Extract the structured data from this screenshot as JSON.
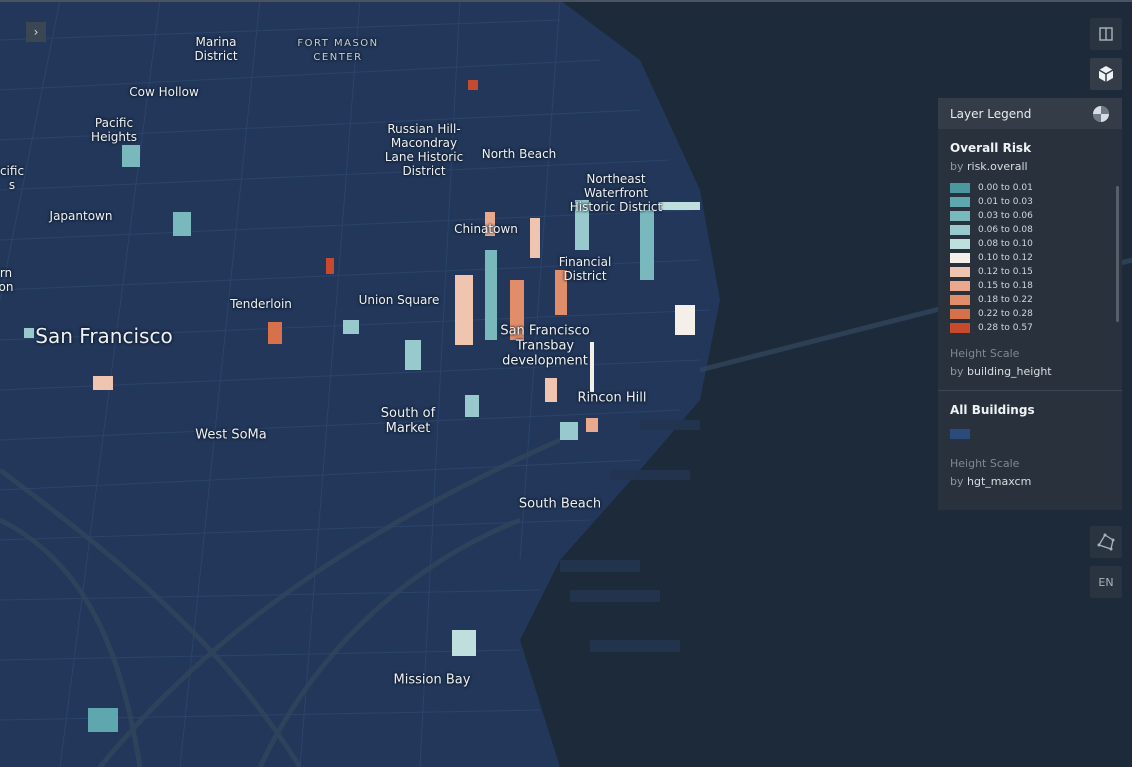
{
  "places": [
    {
      "id": "marina-district",
      "text": "Marina\nDistrict",
      "size": "small"
    },
    {
      "id": "fort-mason-center",
      "text": "FORT MASON\nCENTER",
      "size": "fm"
    },
    {
      "id": "cow-hollow",
      "text": "Cow Hollow",
      "size": "small"
    },
    {
      "id": "pacific-heights",
      "text": "Pacific\nHeights",
      "size": "small"
    },
    {
      "id": "pacific-cut",
      "text": "cific\ns",
      "size": "small"
    },
    {
      "id": "russian-hill",
      "text": "Russian Hill-\nMacondray\nLane Historic\nDistrict",
      "size": "small"
    },
    {
      "id": "north-beach",
      "text": "North Beach",
      "size": "small"
    },
    {
      "id": "northeast-waterfront",
      "text": "Northeast\nWaterfront\nHistoric District",
      "size": "small"
    },
    {
      "id": "japantown",
      "text": "Japantown",
      "size": "small"
    },
    {
      "id": "chinatown",
      "text": "Chinatown",
      "size": "small"
    },
    {
      "id": "financial-district",
      "text": "Financial\nDistrict",
      "size": "small"
    },
    {
      "id": "western-addition-cut",
      "text": "rn\non",
      "size": "small"
    },
    {
      "id": "tenderloin",
      "text": "Tenderloin",
      "size": "small"
    },
    {
      "id": "union-square",
      "text": "Union Square",
      "size": "small"
    },
    {
      "id": "san-francisco",
      "text": "San Francisco",
      "size": "big"
    },
    {
      "id": "transbay",
      "text": "San Francisco\nTransbay\ndevelopment",
      "size": "med"
    },
    {
      "id": "rincon-hill",
      "text": "Rincon Hill",
      "size": "med"
    },
    {
      "id": "south-of-market",
      "text": "South of\nMarket",
      "size": "med"
    },
    {
      "id": "west-soma",
      "text": "West SoMa",
      "size": "med"
    },
    {
      "id": "south-beach",
      "text": "South Beach",
      "size": "med"
    },
    {
      "id": "mission-bay",
      "text": "Mission Bay",
      "size": "med"
    }
  ],
  "controls": {
    "sidebar_toggle": "›",
    "language": "EN"
  },
  "legend": {
    "title": "Layer Legend",
    "layers": [
      {
        "name": "Overall Risk",
        "by_prefix": "by",
        "color_field": "risk.overall",
        "bins": [
          {
            "label": "0.00 to 0.01",
            "color": "#4b97a0"
          },
          {
            "label": "0.01 to 0.03",
            "color": "#5ea7ae"
          },
          {
            "label": "0.03 to 0.06",
            "color": "#79b8bd"
          },
          {
            "label": "0.06 to 0.08",
            "color": "#98cacd"
          },
          {
            "label": "0.08 to 0.10",
            "color": "#bfdfdf"
          },
          {
            "label": "0.10 to 0.12",
            "color": "#f5efea"
          },
          {
            "label": "0.12 to 0.15",
            "color": "#efc5b0"
          },
          {
            "label": "0.15 to 0.18",
            "color": "#eaa98c"
          },
          {
            "label": "0.18 to 0.22",
            "color": "#e18d69"
          },
          {
            "label": "0.22 to 0.28",
            "color": "#d6714a"
          },
          {
            "label": "0.28 to 0.57",
            "color": "#c84a2e"
          }
        ],
        "height_scale_label": "Height Scale",
        "height_field": "building_height"
      },
      {
        "name": "All Buildings",
        "color": "#2c4a7c",
        "height_scale_label": "Height Scale",
        "by_prefix": "by",
        "height_field": "hgt_maxcm"
      }
    ]
  }
}
